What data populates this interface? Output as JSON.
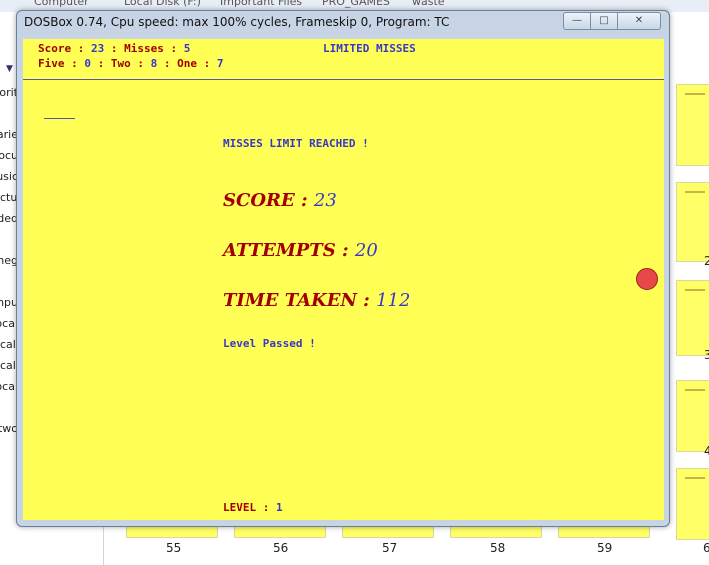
{
  "background": {
    "breadcrumb": [
      "Computer",
      "Local Disk (F:)",
      "Important Files",
      "PRO_GAMES",
      "waste"
    ],
    "nav_items": [
      "orit",
      "arie",
      "ocu",
      "usic",
      "ctu",
      "ided",
      "neg",
      "npu",
      "ocal",
      "cal",
      "cal",
      "ocal",
      "two"
    ],
    "thumbnail_numbers": [
      "55",
      "56",
      "57",
      "58",
      "59",
      "6"
    ],
    "side_numbers": [
      "2",
      "3",
      "4"
    ]
  },
  "window": {
    "title": "DOSBox 0.74, Cpu speed: max 100% cycles, Frameskip  0, Program:      TC",
    "min_glyph": "—",
    "max_glyph": "□",
    "close_glyph": "✕"
  },
  "game": {
    "header": {
      "score_label": "Score : ",
      "score_value": "23",
      "misses_label": " : Misses : ",
      "misses_value": "5",
      "mode": "LIMITED MISSES",
      "five_label": "Five : ",
      "five_value": "0",
      "two_label": " : Two : ",
      "two_value": "8",
      "one_label": " : One : ",
      "one_value": "7"
    },
    "message": "MISSES LIMIT REACHED !",
    "score_label": "SCORE : ",
    "score_value": "23",
    "attempts_label": "ATTEMPTS : ",
    "attempts_value": "20",
    "time_label": "TIME TAKEN : ",
    "time_value": "112",
    "status": "Level Passed !",
    "level_label": "LEVEL : ",
    "level_value": "1"
  },
  "colors": {
    "game_background": "#ffff55",
    "label_red": "#a00000",
    "value_blue": "#3838c8",
    "target_dot": "#e84848"
  }
}
